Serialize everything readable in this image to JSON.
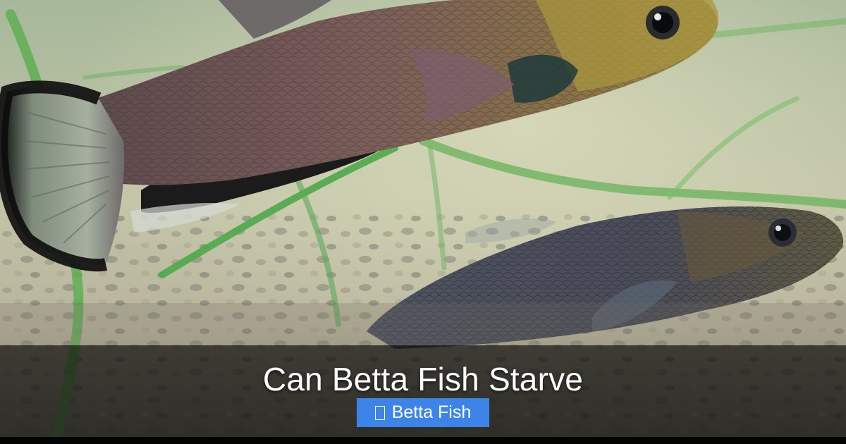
{
  "article": {
    "title": "Can Betta Fish Starve",
    "category": {
      "label": "Betta Fish",
      "icon": "missing-glyph-icon"
    }
  },
  "image": {
    "subject": "fish-in-aquarium-photo"
  },
  "colors": {
    "badge_background": "#3c84e8",
    "overlay": "rgba(0,0,0,0.62)",
    "text": "#ffffff"
  }
}
